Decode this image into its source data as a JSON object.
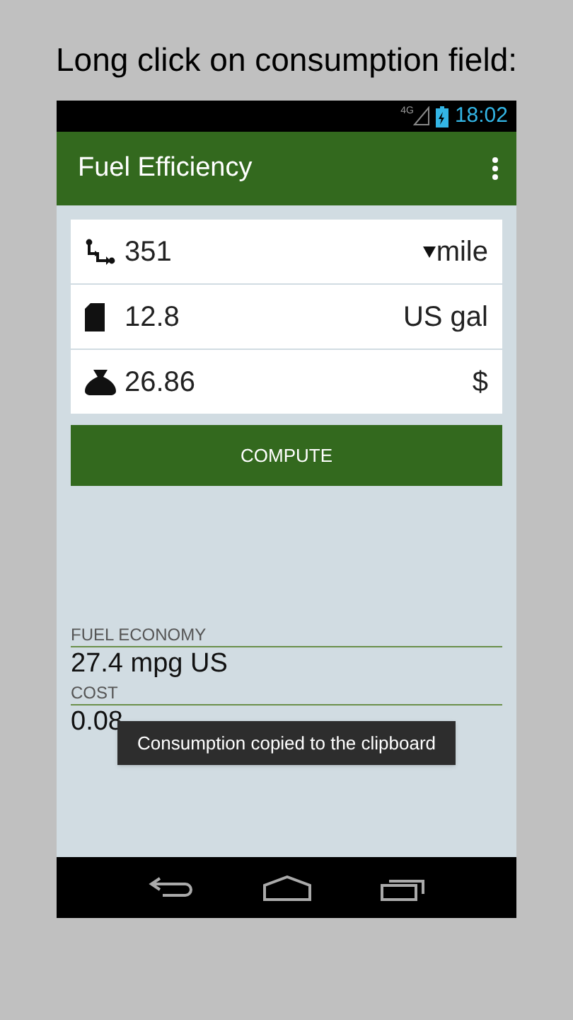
{
  "caption": "Long click on consumption field:",
  "status_bar": {
    "network": "4G",
    "time": "18:02"
  },
  "app_bar": {
    "title": "Fuel Efficiency"
  },
  "inputs": [
    {
      "kind": "distance",
      "value": "351",
      "unit": "mile",
      "dropdown": true
    },
    {
      "kind": "fuel",
      "value": "12.8",
      "unit": "US gal",
      "dropdown": false
    },
    {
      "kind": "money",
      "value": "26.86",
      "unit": "$",
      "dropdown": false
    }
  ],
  "compute_button": "COMPUTE",
  "results": [
    {
      "label": "FUEL ECONOMY",
      "value": "27.4 mpg US"
    },
    {
      "label": "COST",
      "value": "0.08"
    }
  ],
  "toast": "Consumption copied to the clipboard"
}
